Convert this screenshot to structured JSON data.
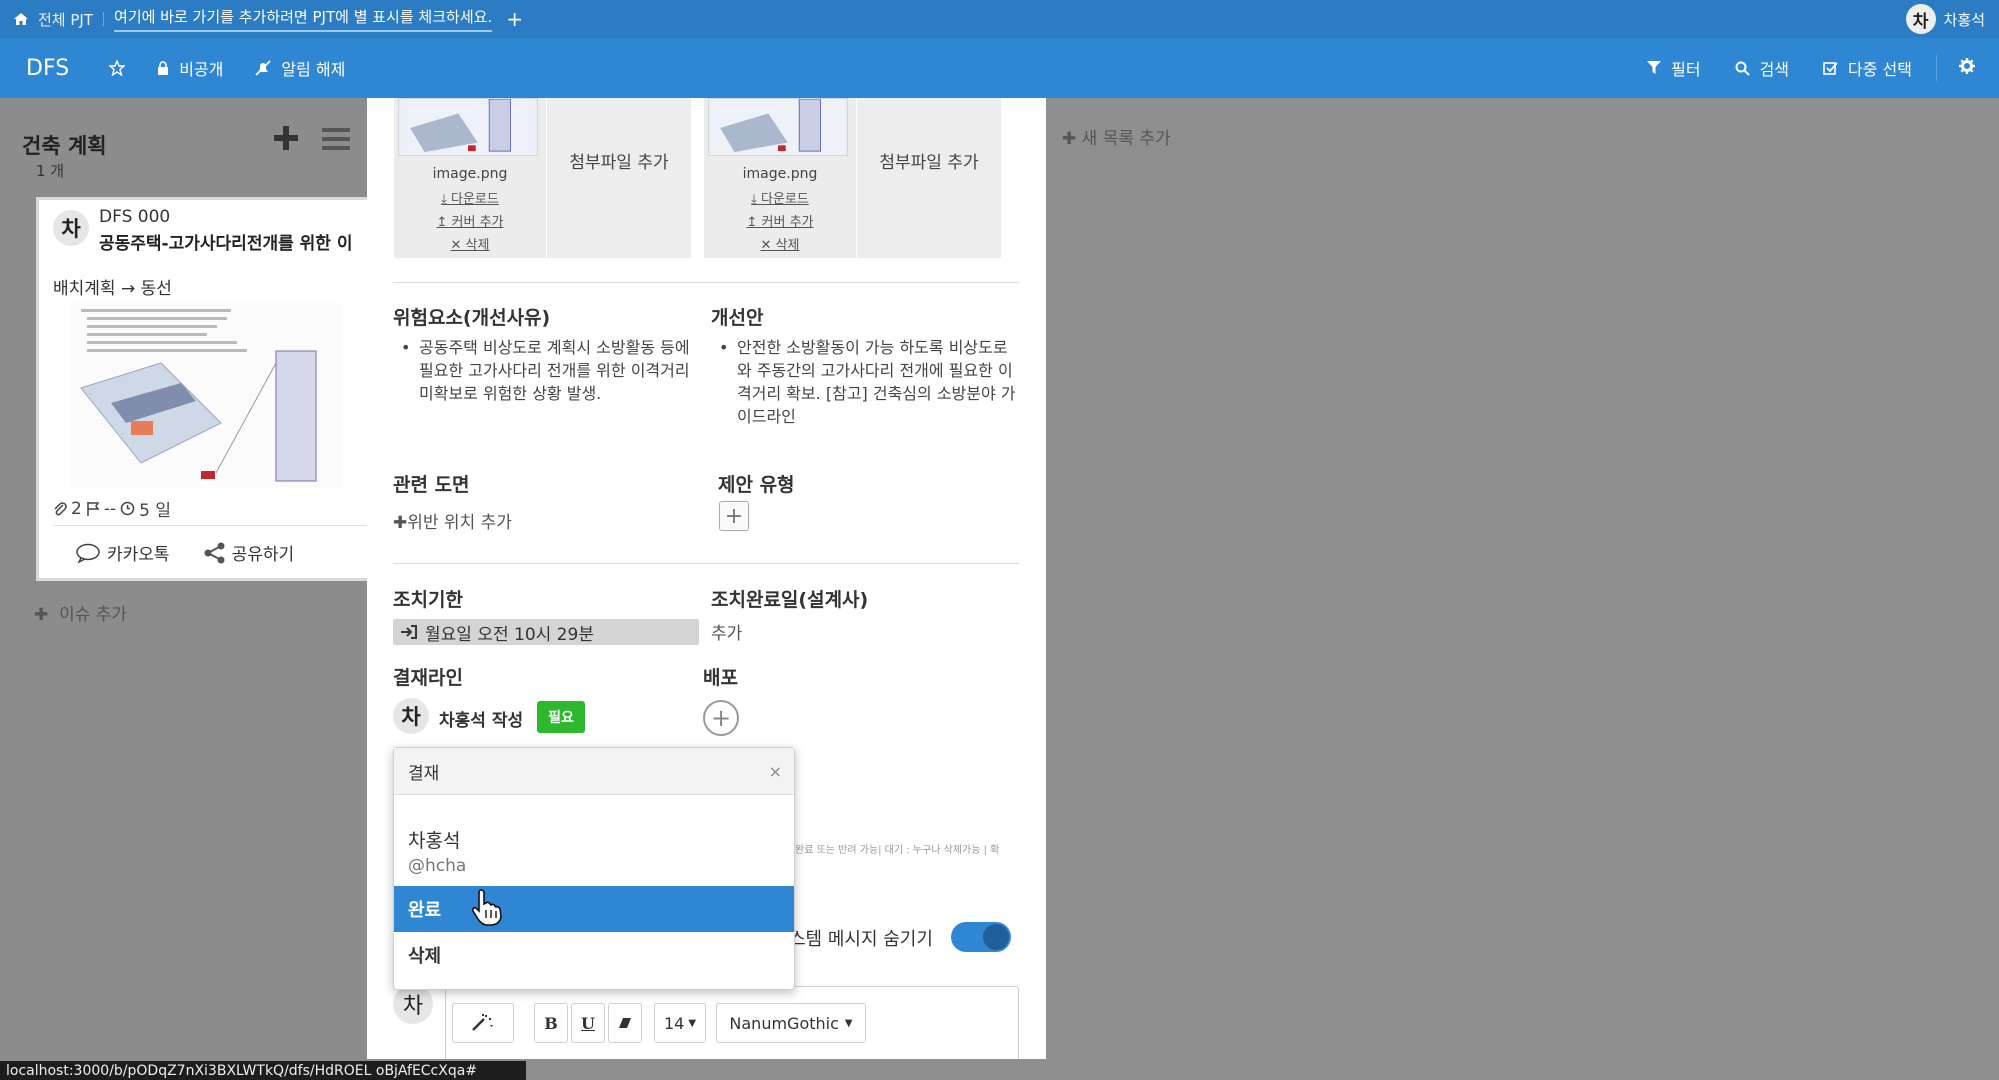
{
  "topbar": {
    "all_pjt": "전체 PJT",
    "hint_tab": "여기에 바로 가기를 추가하려면 PJT에 별 표시를 체크하세요.",
    "user_initial": "차",
    "user_name": "차홍석"
  },
  "boardbar": {
    "board_name": "DFS",
    "private_label": "비공개",
    "notify_label": "알림 해제",
    "filter_label": "필터",
    "search_label": "검색",
    "multi_select_label": "다중 선택"
  },
  "list": {
    "title": "건축 계획",
    "count": "1 개",
    "add_issue": "이슈 추가"
  },
  "card": {
    "initial": "차",
    "code": "DFS 000",
    "title": "공동주택-고가사다리전개를 위한 이",
    "subtitle": "배치계획 → 동선",
    "attachments": "2",
    "due": "--",
    "days": "5 일",
    "kakao_label": "카카오톡",
    "share_label": "공유하기"
  },
  "new_list": "새 목록 추가",
  "detail": {
    "attachments": [
      {
        "name": "image.png",
        "download": "다운로드",
        "cover": "커버 추가",
        "delete": "삭제"
      },
      {
        "name": "image.png",
        "download": "다운로드",
        "cover": "커버 추가",
        "delete": "삭제"
      }
    ],
    "add_attachment": "첨부파일 추가",
    "risk_title": "위험요소(개선사유)",
    "risk_text": "공동주택 비상도로 계획시 소방활동 등에 필요한 고가사다리 전개를 위한 이격거리 미확보로 위험한 상황 발생.",
    "improve_title": "개선안",
    "improve_text": "안전한 소방활동이 가능 하도록 비상도로와 주동간의 고가사다리 전개에 필요한 이격거리 확보. [참고] 건축심의 소방분야 가이드라인",
    "drawing_title": "관련 도면",
    "drawing_add": "위반 위치 추가",
    "proposal_title": "제안 유형",
    "deadline_title": "조치기한",
    "deadline_value": "월요일 오전 10시 29분",
    "done_title": "조치완료일(설계사)",
    "done_value": "추가",
    "approval_title": "결재라인",
    "approver_initial": "차",
    "approver_text": "차홍석 작성",
    "need_badge": "필요",
    "distribution_title": "배포",
    "hint_text": "완료 또는 반려 가능| 대기 : 누구나 삭제가능 | 확",
    "sysmsg_label": "스템 메시지 숨기기",
    "editor_initial": "차",
    "font_size": "14",
    "font_name": "NanumGothic",
    "bold": "B",
    "underline": "U"
  },
  "popover": {
    "title": "결재",
    "close": "×",
    "user_name": "차홍석",
    "user_handle": "@hcha",
    "items": [
      "완료",
      "삭제"
    ]
  },
  "statusbar": "localhost:3000/b/pODqZ7nXi3BXLWTkQ/dfs/HdROEL oBjAfECcXqa#",
  "colors": {
    "topbar": "#2b7cc3",
    "boardbar": "#2f86d3",
    "selected": "#2f86d3",
    "badge": "#2eb82e"
  }
}
